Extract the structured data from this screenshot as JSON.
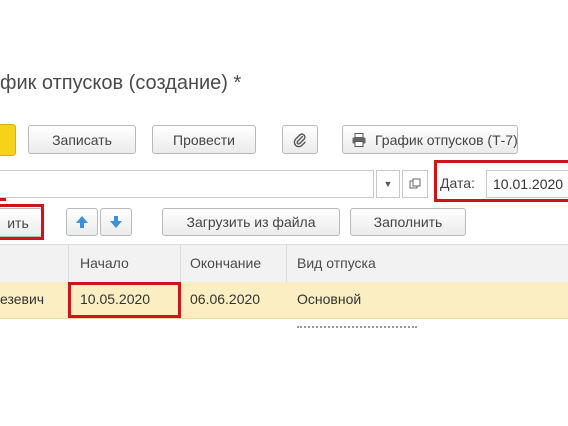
{
  "header": {
    "title": "фик отпусков (создание) *"
  },
  "toolbar": {
    "save_label": "Записать",
    "post_label": "Провести",
    "print_label": "График отпусков (Т-7)",
    "attach_icon": "paperclip-icon",
    "print_icon": "printer-icon",
    "primary_color": "#f7d21a"
  },
  "form": {
    "date_label": "Дата:",
    "date_value": "10.01.2020"
  },
  "table_toolbar": {
    "add_label": "ить",
    "up_icon": "arrow-up-icon",
    "down_icon": "arrow-down-icon",
    "load_label": "Загрузить из файла",
    "fill_label": "Заполнить"
  },
  "table": {
    "headers": [
      "Начало",
      "Окончание",
      "Вид отпуска"
    ],
    "rows": [
      {
        "employee": "езевич",
        "start": "10.05.2020",
        "end": "06.06.2020",
        "type": "Основной"
      }
    ]
  },
  "highlight_color": "#d0121b"
}
